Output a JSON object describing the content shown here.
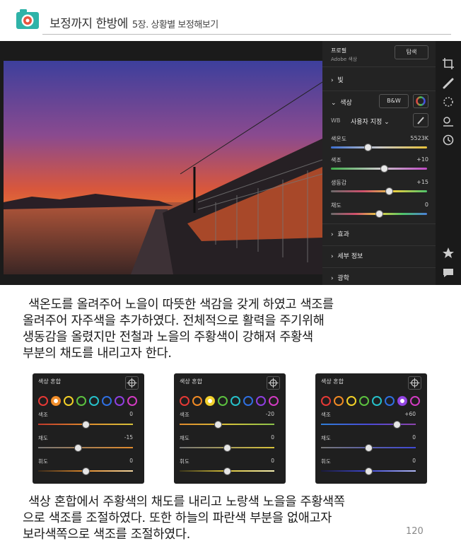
{
  "header": {
    "title": "보정까지 한방에",
    "chapter": "5장. 상황별 보정해보기"
  },
  "lightroom": {
    "profile": {
      "label": "프로필",
      "value": "Adobe 색상",
      "browse": "탐색"
    },
    "sections": {
      "light": "빛",
      "color": "색상",
      "effects": "효과",
      "detail": "세부 정보",
      "optics": "광학"
    },
    "bw_button": "B&W",
    "wb": {
      "label": "WB",
      "value": "사용자 지정 ⌄"
    },
    "sliders": [
      {
        "label": "색온도",
        "value": "5523K",
        "level": 0.38,
        "gradient": "linear-gradient(90deg,#3d6fd0,#c9c9c9,#e7c13a)"
      },
      {
        "label": "색조",
        "value": "+10",
        "level": 0.55,
        "gradient": "linear-gradient(90deg,#3fae4a,#c9c9c9,#c04ac6)"
      },
      {
        "label": "생동감",
        "value": "+15",
        "level": 0.6,
        "gradient": "linear-gradient(90deg,#6a6a6a,#cf4f6c,#e6cf42,#4ec36a)"
      },
      {
        "label": "채도",
        "value": "0",
        "level": 0.5,
        "gradient": "linear-gradient(90deg,#6a6a6a,#cf4f6c,#e6cf42,#4ec36a,#4a7fd8)"
      }
    ]
  },
  "paragraph1": [
    "색온도를 올려주어 노을이 따뜻한 색감을 갖게 하였고 색조를",
    "올려주어 자주색을 추가하였다. 전체적으로 활력을 주기위해",
    "생동감을 올렸지만  전철과 노을의 주황색이 강해져 주황색",
    "부분의 채도를 내리고자 한다."
  ],
  "mixers": [
    {
      "title": "색상 혼합",
      "selected": 1,
      "rows": [
        {
          "label": "색조",
          "value": "0",
          "level": 0.5,
          "gradient": "linear-gradient(90deg,#c0392b,#e08a2c,#d8c23a)"
        },
        {
          "label": "채도",
          "value": "-15",
          "level": 0.42,
          "gradient": "linear-gradient(90deg,#777,#e08a2c)"
        },
        {
          "label": "휘도",
          "value": "0",
          "level": 0.5,
          "gradient": "linear-gradient(90deg,#3a2a1a,#e08a2c,#f3d6a0)"
        }
      ]
    },
    {
      "title": "색상 혼합",
      "selected": 2,
      "rows": [
        {
          "label": "색조",
          "value": "-20",
          "level": 0.4,
          "gradient": "linear-gradient(90deg,#e08a2c,#d8c23a,#8bc34a)"
        },
        {
          "label": "채도",
          "value": "0",
          "level": 0.5,
          "gradient": "linear-gradient(90deg,#777,#d8c23a)"
        },
        {
          "label": "휘도",
          "value": "0",
          "level": 0.5,
          "gradient": "linear-gradient(90deg,#3a351a,#d8c23a,#f5eeb0)"
        }
      ]
    },
    {
      "title": "색상 혼합",
      "selected": 6,
      "rows": [
        {
          "label": "색조",
          "value": "+60",
          "level": 0.8,
          "gradient": "linear-gradient(90deg,#2f7fd8,#4a4ad8,#8e44ad)"
        },
        {
          "label": "채도",
          "value": "0",
          "level": 0.5,
          "gradient": "linear-gradient(90deg,#777,#3f49d6)"
        },
        {
          "label": "휘도",
          "value": "0",
          "level": 0.5,
          "gradient": "linear-gradient(90deg,#1a1a3a,#3f49d6,#b0b8f5)"
        }
      ]
    }
  ],
  "ring_colors": [
    "#e53935",
    "#f08a24",
    "#f2d027",
    "#5cc13f",
    "#26c0c9",
    "#2f6fe0",
    "#8e3fe0",
    "#d23bc2"
  ],
  "paragraph2": [
    "색상 혼합에서 주황색의 채도를 내리고 노랑색 노을을 주황색쪽",
    "으로 색조를 조절하였다. 또한 하늘의 파란색 부분을 없애고자",
    "보라색쪽으로 색조를 조절하였다."
  ],
  "page_number": "120"
}
